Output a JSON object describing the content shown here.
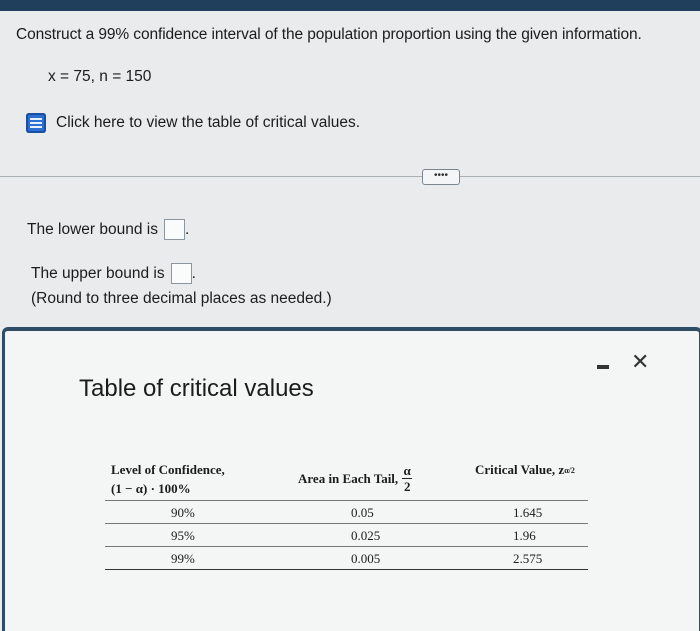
{
  "question": {
    "prompt": "Construct a 99% confidence interval of the population proportion using the given information.",
    "given": "x = 75, n = 150"
  },
  "help": {
    "link_label": "Click here to view the table of critical values."
  },
  "more_button": {
    "label": "••••"
  },
  "answers": {
    "lower_label": "The lower bound is",
    "upper_label": "The upper bound is",
    "lower_value": "",
    "upper_value": "",
    "note": "(Round to three decimal places as needed.)"
  },
  "modal": {
    "title": "Table of critical values",
    "minimize_label": "–",
    "close_label": "✕",
    "table": {
      "headers": {
        "level": "Level of Confidence,",
        "level_sub": "(1 − α) · 100%",
        "area": "Area in Each Tail,",
        "area_num": "α",
        "area_den": "2",
        "critical": "Critical Value, z",
        "critical_sub": "α/2"
      },
      "rows": [
        {
          "level": "90%",
          "area": "0.05",
          "critical": "1.645"
        },
        {
          "level": "95%",
          "area": "0.025",
          "critical": "1.96"
        },
        {
          "level": "99%",
          "area": "0.005",
          "critical": "2.575"
        }
      ]
    }
  },
  "colors": {
    "topbar": "#1f3f5c",
    "help_icon": "#2b6fd3",
    "modal_border": "#2f4e66"
  }
}
